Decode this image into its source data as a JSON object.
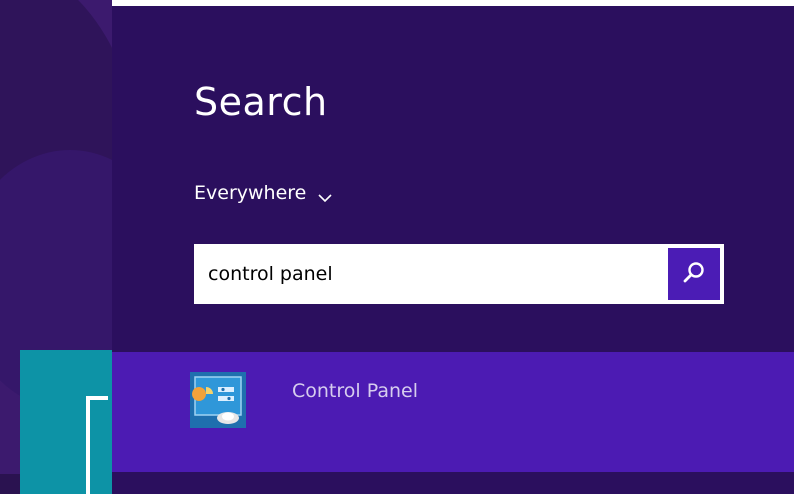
{
  "charm": {
    "title": "Search",
    "scope_label": "Everywhere",
    "scope_icon": "chevron-down-icon",
    "search_value": "control panel",
    "search_button_icon": "search-icon"
  },
  "results": [
    {
      "label": "Control Panel",
      "icon": "control-panel-icon"
    }
  ],
  "colors": {
    "charm_background": "#2b0f5e",
    "result_highlight": "#4c1bb3",
    "search_button": "#4b1cb5",
    "tile_accent": "#0d93a6"
  }
}
